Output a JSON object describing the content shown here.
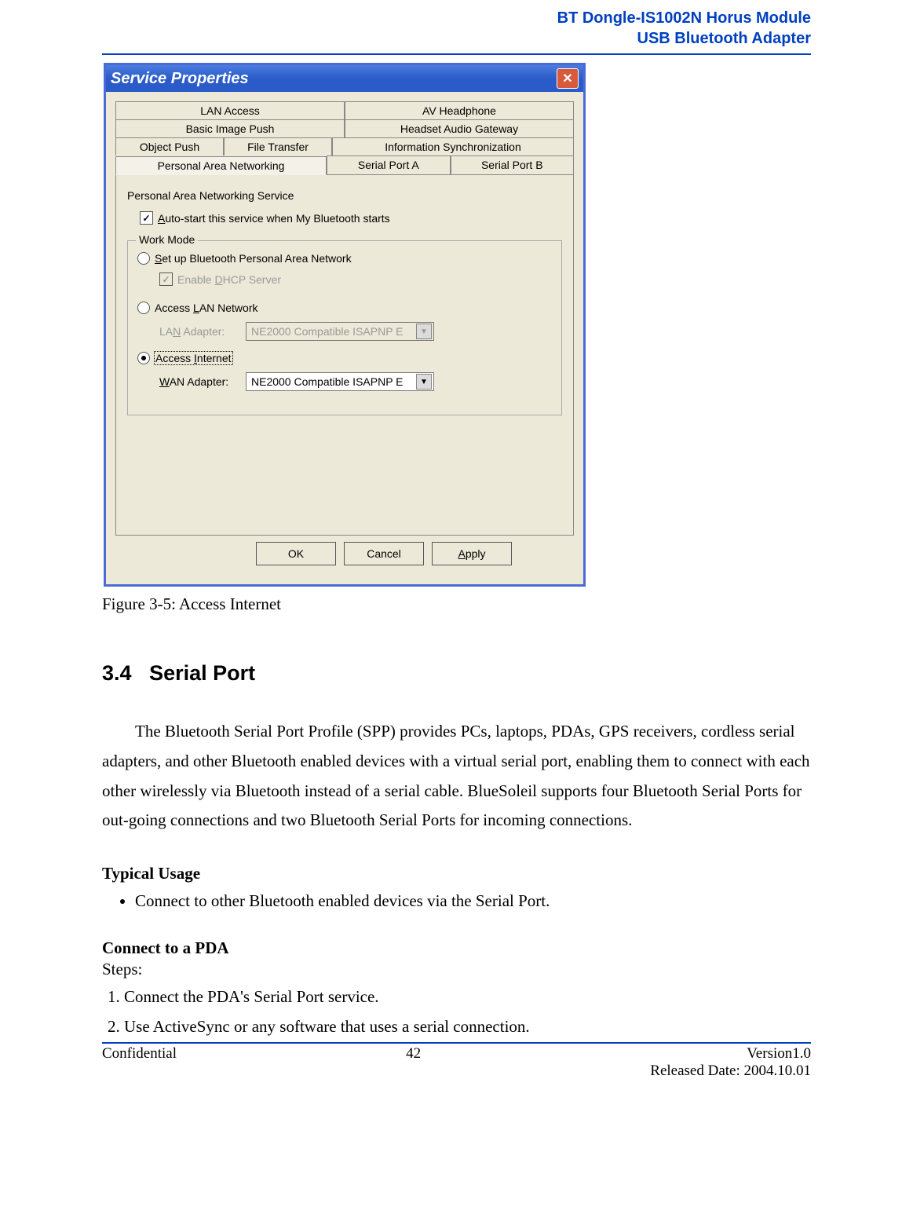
{
  "header": {
    "line1": "BT Dongle-IS1002N Horus Module",
    "line2": "USB Bluetooth Adapter"
  },
  "dialog": {
    "title": "Service Properties",
    "close": "✕",
    "tabs": {
      "row1": [
        "LAN Access",
        "AV Headphone"
      ],
      "row2": [
        "Basic Image Push",
        "Headset Audio Gateway"
      ],
      "row3": [
        "Object Push",
        "File Transfer",
        "Information Synchronization"
      ],
      "row4": [
        "Personal Area Networking",
        "Serial Port A",
        "Serial Port B"
      ]
    },
    "service_name": "Personal Area Networking Service",
    "autostart_prefix": "A",
    "autostart_rest": "uto-start this service when My Bluetooth starts",
    "workmode_legend": "Work Mode",
    "opt1_prefix": "S",
    "opt1_rest": "et up Bluetooth Personal Area Network",
    "enable_dhcp_text": "Enable ",
    "enable_dhcp_u": "D",
    "enable_dhcp_rest": "HCP Server",
    "opt2_text": "Access ",
    "opt2_u": "L",
    "opt2_rest": "AN Network",
    "lan_label_pre": "LA",
    "lan_label_u": "N",
    "lan_label_post": " Adapter:",
    "lan_value": "NE2000 Compatible ISAPNP E",
    "opt3_text": "Access ",
    "opt3_u": "I",
    "opt3_rest": "nternet",
    "wan_label_u": "W",
    "wan_label_post": "AN Adapter:",
    "wan_value": "NE2000 Compatible ISAPNP E",
    "btn_ok": "OK",
    "btn_cancel": "Cancel",
    "btn_apply_u": "A",
    "btn_apply_rest": "pply"
  },
  "caption": "Figure 3-5: Access Internet",
  "section": {
    "num": "3.4",
    "title": "Serial Port"
  },
  "para": "The Bluetooth Serial Port Profile (SPP) provides PCs, laptops, PDAs, GPS receivers, cordless serial adapters, and other Bluetooth enabled devices with a virtual serial port, enabling them to connect with each other wirelessly via Bluetooth instead of a serial cable. BlueSoleil supports four Bluetooth Serial Ports for out-going connections and two Bluetooth Serial Ports for incoming connections.",
  "typical_usage_heading": "Typical Usage",
  "typical_usage_item": "Connect to other Bluetooth enabled devices via the Serial Port.",
  "connect_pda_heading": "Connect to a PDA",
  "steps_label": "Steps:",
  "step1": "Connect the PDA's Serial Port service.",
  "step2": "Use ActiveSync or any software that uses a serial connection.",
  "footer": {
    "left": "Confidential",
    "center": "42",
    "right1": "Version1.0",
    "right2": "Released Date: 2004.10.01"
  }
}
